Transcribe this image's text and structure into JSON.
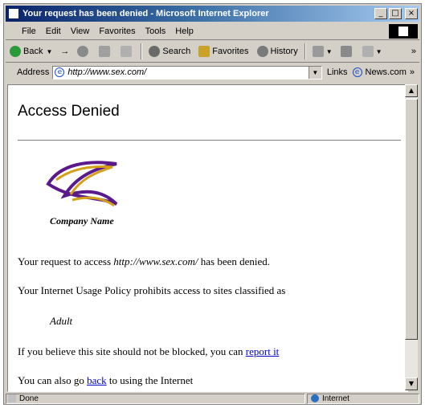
{
  "window": {
    "title": "Your request has been denied - Microsoft Internet Explorer",
    "controls": [
      "_",
      "□",
      "×"
    ]
  },
  "menu": [
    "File",
    "Edit",
    "View",
    "Favorites",
    "Tools",
    "Help"
  ],
  "toolbar": {
    "back": "Back",
    "forward": "→",
    "search": "Search",
    "favorites": "Favorites",
    "history": "History"
  },
  "address": {
    "label": "Address",
    "value": "http://www.sex.com/",
    "links_label": "Links",
    "links_item": "News.com",
    "overflow": "»"
  },
  "page": {
    "heading": "Access Denied",
    "company": "Company Name",
    "line1_pre": "Your request to access ",
    "line1_url": "http://www.sex.com/",
    "line1_post": " has been denied.",
    "line2": "Your Internet Usage Policy prohibits access to sites classified as",
    "category": "Adult",
    "line3_pre": "If you believe this site should not be blocked, you can ",
    "line3_link": "report it",
    "line4_pre": "You can also go ",
    "line4_link": "back",
    "line4_post": " to using the Internet"
  },
  "status": {
    "left": "Done",
    "zone": "Internet"
  },
  "colors": {
    "titlebar": "#0a246a",
    "link": "#0000cc",
    "logo_purple": "#5a1a8a",
    "logo_gold": "#d4a017"
  }
}
